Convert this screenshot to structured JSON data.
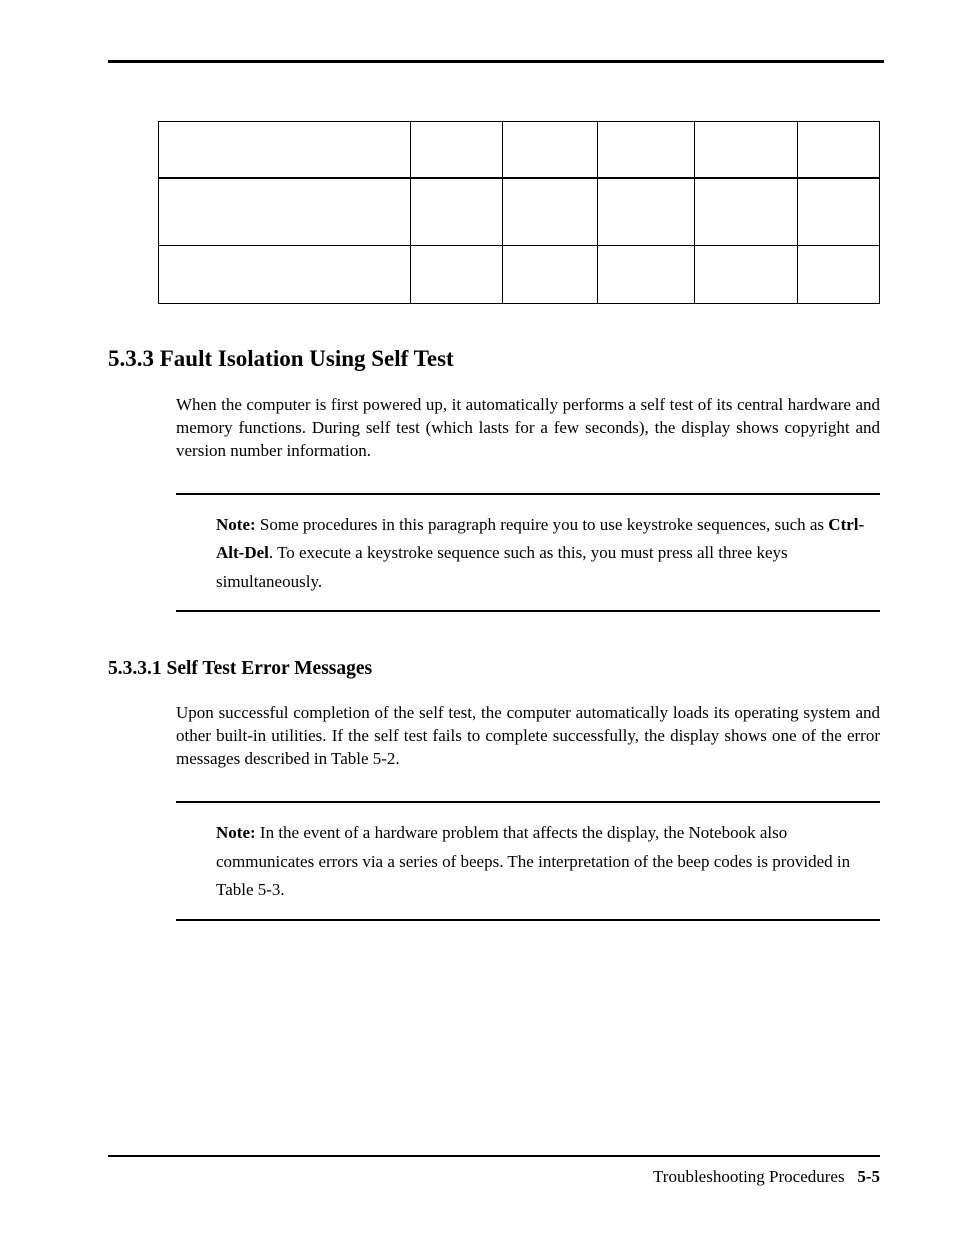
{
  "heading_1_num": "5.3.3",
  "heading_1_title": "Fault Isolation Using Self Test",
  "para_1": "When the computer is first powered up, it automatically performs a self test of its central hardware and memory functions. During self test (which lasts for a few seconds), the display shows copyright and version number information.",
  "note_1_label": "Note:",
  "note_1_a": "Some procedures in this paragraph require you to use keystroke sequences, such as ",
  "note_1_key": "Ctrl-Alt-Del",
  "note_1_b": ". To execute a keystroke sequence such as this, you must press all three keys simultaneously.",
  "heading_2_num": "5.3.3.1",
  "heading_2_title": "Self Test Error Messages",
  "para_2": "Upon successful completion of the self test, the computer automatically loads its operating system and other built-in utilities. If the self test fails to complete successfully, the display shows one of the error messages described in Table 5-2.",
  "note_2_label": "Note:",
  "note_2_text": "In the event of a hardware problem that affects the display, the Notebook also communicates errors via a series of beeps. The interpretation of the beep codes is provided in Table 5-3.",
  "footer_text": "Troubleshooting Procedures",
  "footer_page": "5-5"
}
